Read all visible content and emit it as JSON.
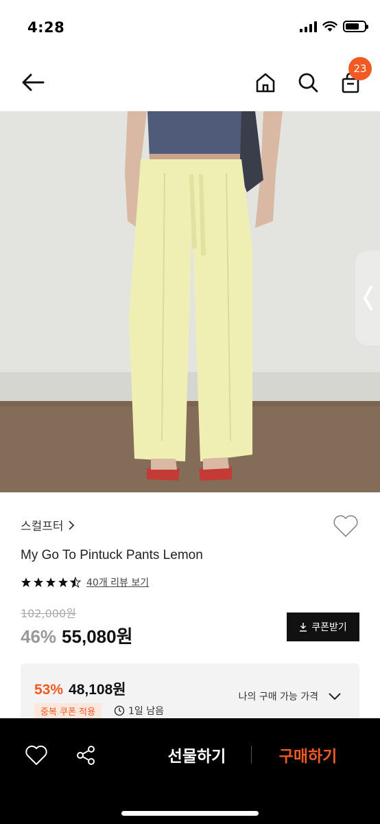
{
  "status_bar": {
    "time": "4:28",
    "battery_level": 0.74
  },
  "header": {
    "cart_count": "23",
    "icons": [
      "back-arrow-icon",
      "home-icon",
      "search-icon",
      "cart-icon"
    ]
  },
  "product": {
    "brand": "스컬프터",
    "title": "My Go To Pintuck Pants Lemon",
    "rating": 4.5,
    "review_link": "40개 리뷰 보기",
    "original_price": "102,000원",
    "discount_rate": "46%",
    "sale_price": "55,080원",
    "coupon_button": "쿠폰받기"
  },
  "best_price": {
    "discount_rate": "53%",
    "price": "48,108원",
    "coupon_tag": "중복 쿠폰 적용",
    "time_left": "1일 남음",
    "my_price_label": "나의 구매 가능 가격"
  },
  "bottom_bar": {
    "gift_label": "선물하기",
    "buy_label": "구매하기"
  },
  "colors": {
    "accent": "#f25a24",
    "dark": "#000000"
  }
}
